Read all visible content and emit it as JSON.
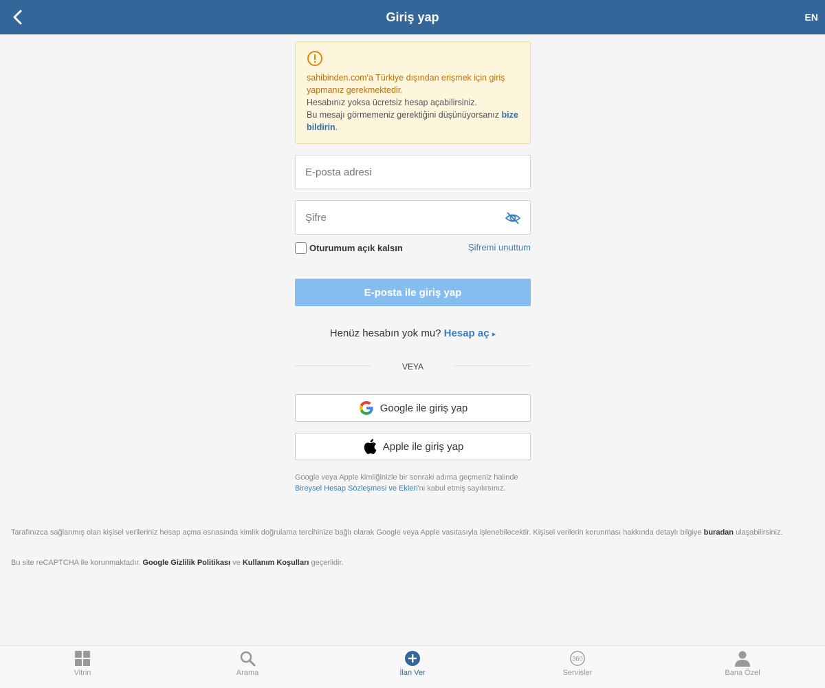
{
  "header": {
    "title": "Giriş yap",
    "lang": "EN"
  },
  "alert": {
    "warning": "sahibinden.com'a Türkiye dışından erişmek için giriş yapmanız gerekmektedir.",
    "line2": "Hesabınız yoksa ücretsiz hesap açabilirsiniz.",
    "line3_prefix": "Bu mesajı görmemeniz gerektiğini düşünüyorsanız ",
    "line3_link": "bize bildirin",
    "line3_suffix": "."
  },
  "form": {
    "email_placeholder": "E-posta adresi",
    "password_placeholder": "Şifre",
    "remember_label": "Oturumum açık kalsın",
    "forgot_label": "Şifremi unuttum",
    "submit_label": "E-posta ile giriş yap"
  },
  "signup": {
    "question": "Henüz hesabın yok mu?",
    "link": "Hesap aç",
    "arrow": "▸"
  },
  "divider_label": "VEYA",
  "social": {
    "google_label": "Google ile giriş yap",
    "apple_label": "Apple ile giriş yap"
  },
  "consent": {
    "prefix": "Google veya Apple kimliğinizle bir sonraki adıma geçmeniz halinde ",
    "link": "Bireysel Hesap Sözleşmesi ve Ekleri",
    "suffix": "'ni kabul etmiş sayılırsınız."
  },
  "footer": {
    "privacy_text": "Tarafınızca sağlanmış olan kişisel verileriniz hesap açma esnasında kimlik doğrulama tercihinize bağlı olarak Google veya Apple vasıtasıyla işlenebilecektir. Kişisel verilerin korunması hakkında detaylı bilgiye ",
    "privacy_link": "buradan",
    "privacy_suffix": " ulaşabilirsiniz.",
    "recaptcha_prefix": "Bu site reCAPTCHA ile korunmaktadır. ",
    "recaptcha_link1": "Google Gizlilik Politikası",
    "recaptcha_mid": " ve ",
    "recaptcha_link2": "Kullanım Koşulları",
    "recaptcha_suffix": " geçerlidir."
  },
  "tabbar": {
    "tabs": [
      {
        "label": "Vitrin",
        "icon": "grid-icon"
      },
      {
        "label": "Arama",
        "icon": "search-icon"
      },
      {
        "label": "İlan Ver",
        "icon": "plus-circle-icon",
        "active": true
      },
      {
        "label": "Servisler",
        "icon": "360-icon"
      },
      {
        "label": "Bana Özel",
        "icon": "user-icon"
      }
    ]
  },
  "colors": {
    "header": "#336699",
    "accent": "#3a7fc1",
    "button_disabled": "#85bdf0",
    "alert_bg": "#fdf5dc",
    "alert_warn": "#c2710b"
  }
}
